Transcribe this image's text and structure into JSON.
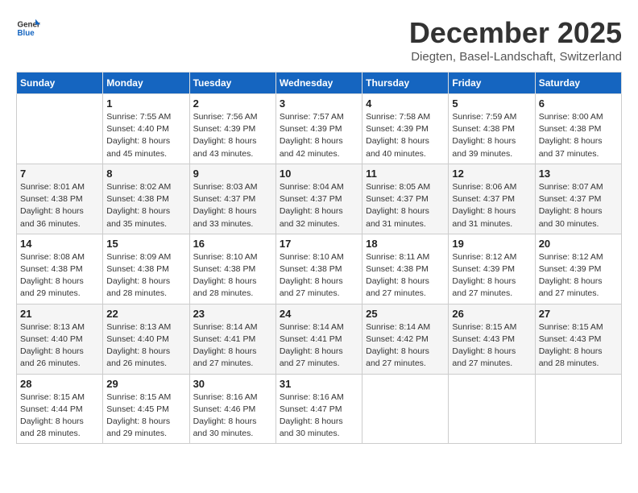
{
  "header": {
    "logo_general": "General",
    "logo_blue": "Blue",
    "month": "December 2025",
    "location": "Diegten, Basel-Landschaft, Switzerland"
  },
  "weekdays": [
    "Sunday",
    "Monday",
    "Tuesday",
    "Wednesday",
    "Thursday",
    "Friday",
    "Saturday"
  ],
  "weeks": [
    [
      {
        "day": "",
        "sunrise": "",
        "sunset": "",
        "daylight": ""
      },
      {
        "day": "1",
        "sunrise": "Sunrise: 7:55 AM",
        "sunset": "Sunset: 4:40 PM",
        "daylight": "Daylight: 8 hours and 45 minutes."
      },
      {
        "day": "2",
        "sunrise": "Sunrise: 7:56 AM",
        "sunset": "Sunset: 4:39 PM",
        "daylight": "Daylight: 8 hours and 43 minutes."
      },
      {
        "day": "3",
        "sunrise": "Sunrise: 7:57 AM",
        "sunset": "Sunset: 4:39 PM",
        "daylight": "Daylight: 8 hours and 42 minutes."
      },
      {
        "day": "4",
        "sunrise": "Sunrise: 7:58 AM",
        "sunset": "Sunset: 4:39 PM",
        "daylight": "Daylight: 8 hours and 40 minutes."
      },
      {
        "day": "5",
        "sunrise": "Sunrise: 7:59 AM",
        "sunset": "Sunset: 4:38 PM",
        "daylight": "Daylight: 8 hours and 39 minutes."
      },
      {
        "day": "6",
        "sunrise": "Sunrise: 8:00 AM",
        "sunset": "Sunset: 4:38 PM",
        "daylight": "Daylight: 8 hours and 37 minutes."
      }
    ],
    [
      {
        "day": "7",
        "sunrise": "Sunrise: 8:01 AM",
        "sunset": "Sunset: 4:38 PM",
        "daylight": "Daylight: 8 hours and 36 minutes."
      },
      {
        "day": "8",
        "sunrise": "Sunrise: 8:02 AM",
        "sunset": "Sunset: 4:38 PM",
        "daylight": "Daylight: 8 hours and 35 minutes."
      },
      {
        "day": "9",
        "sunrise": "Sunrise: 8:03 AM",
        "sunset": "Sunset: 4:37 PM",
        "daylight": "Daylight: 8 hours and 33 minutes."
      },
      {
        "day": "10",
        "sunrise": "Sunrise: 8:04 AM",
        "sunset": "Sunset: 4:37 PM",
        "daylight": "Daylight: 8 hours and 32 minutes."
      },
      {
        "day": "11",
        "sunrise": "Sunrise: 8:05 AM",
        "sunset": "Sunset: 4:37 PM",
        "daylight": "Daylight: 8 hours and 31 minutes."
      },
      {
        "day": "12",
        "sunrise": "Sunrise: 8:06 AM",
        "sunset": "Sunset: 4:37 PM",
        "daylight": "Daylight: 8 hours and 31 minutes."
      },
      {
        "day": "13",
        "sunrise": "Sunrise: 8:07 AM",
        "sunset": "Sunset: 4:37 PM",
        "daylight": "Daylight: 8 hours and 30 minutes."
      }
    ],
    [
      {
        "day": "14",
        "sunrise": "Sunrise: 8:08 AM",
        "sunset": "Sunset: 4:38 PM",
        "daylight": "Daylight: 8 hours and 29 minutes."
      },
      {
        "day": "15",
        "sunrise": "Sunrise: 8:09 AM",
        "sunset": "Sunset: 4:38 PM",
        "daylight": "Daylight: 8 hours and 28 minutes."
      },
      {
        "day": "16",
        "sunrise": "Sunrise: 8:10 AM",
        "sunset": "Sunset: 4:38 PM",
        "daylight": "Daylight: 8 hours and 28 minutes."
      },
      {
        "day": "17",
        "sunrise": "Sunrise: 8:10 AM",
        "sunset": "Sunset: 4:38 PM",
        "daylight": "Daylight: 8 hours and 27 minutes."
      },
      {
        "day": "18",
        "sunrise": "Sunrise: 8:11 AM",
        "sunset": "Sunset: 4:38 PM",
        "daylight": "Daylight: 8 hours and 27 minutes."
      },
      {
        "day": "19",
        "sunrise": "Sunrise: 8:12 AM",
        "sunset": "Sunset: 4:39 PM",
        "daylight": "Daylight: 8 hours and 27 minutes."
      },
      {
        "day": "20",
        "sunrise": "Sunrise: 8:12 AM",
        "sunset": "Sunset: 4:39 PM",
        "daylight": "Daylight: 8 hours and 27 minutes."
      }
    ],
    [
      {
        "day": "21",
        "sunrise": "Sunrise: 8:13 AM",
        "sunset": "Sunset: 4:40 PM",
        "daylight": "Daylight: 8 hours and 26 minutes."
      },
      {
        "day": "22",
        "sunrise": "Sunrise: 8:13 AM",
        "sunset": "Sunset: 4:40 PM",
        "daylight": "Daylight: 8 hours and 26 minutes."
      },
      {
        "day": "23",
        "sunrise": "Sunrise: 8:14 AM",
        "sunset": "Sunset: 4:41 PM",
        "daylight": "Daylight: 8 hours and 27 minutes."
      },
      {
        "day": "24",
        "sunrise": "Sunrise: 8:14 AM",
        "sunset": "Sunset: 4:41 PM",
        "daylight": "Daylight: 8 hours and 27 minutes."
      },
      {
        "day": "25",
        "sunrise": "Sunrise: 8:14 AM",
        "sunset": "Sunset: 4:42 PM",
        "daylight": "Daylight: 8 hours and 27 minutes."
      },
      {
        "day": "26",
        "sunrise": "Sunrise: 8:15 AM",
        "sunset": "Sunset: 4:43 PM",
        "daylight": "Daylight: 8 hours and 27 minutes."
      },
      {
        "day": "27",
        "sunrise": "Sunrise: 8:15 AM",
        "sunset": "Sunset: 4:43 PM",
        "daylight": "Daylight: 8 hours and 28 minutes."
      }
    ],
    [
      {
        "day": "28",
        "sunrise": "Sunrise: 8:15 AM",
        "sunset": "Sunset: 4:44 PM",
        "daylight": "Daylight: 8 hours and 28 minutes."
      },
      {
        "day": "29",
        "sunrise": "Sunrise: 8:15 AM",
        "sunset": "Sunset: 4:45 PM",
        "daylight": "Daylight: 8 hours and 29 minutes."
      },
      {
        "day": "30",
        "sunrise": "Sunrise: 8:16 AM",
        "sunset": "Sunset: 4:46 PM",
        "daylight": "Daylight: 8 hours and 30 minutes."
      },
      {
        "day": "31",
        "sunrise": "Sunrise: 8:16 AM",
        "sunset": "Sunset: 4:47 PM",
        "daylight": "Daylight: 8 hours and 30 minutes."
      },
      {
        "day": "",
        "sunrise": "",
        "sunset": "",
        "daylight": ""
      },
      {
        "day": "",
        "sunrise": "",
        "sunset": "",
        "daylight": ""
      },
      {
        "day": "",
        "sunrise": "",
        "sunset": "",
        "daylight": ""
      }
    ]
  ]
}
